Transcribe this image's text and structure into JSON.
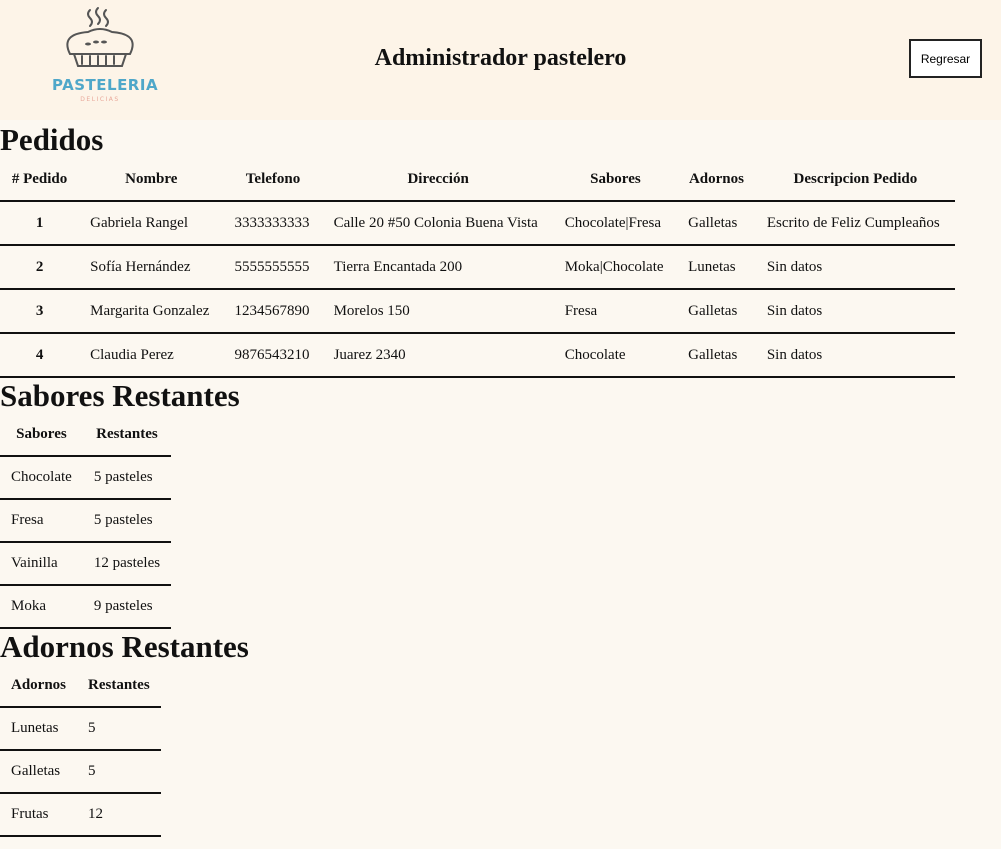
{
  "header": {
    "logo_text": "PASTELERIA",
    "logo_sub": "DELICIAS",
    "title": "Administrador pastelero",
    "back_label": "Regresar"
  },
  "pedidos": {
    "title": "Pedidos",
    "columns": [
      "# Pedido",
      "Nombre",
      "Telefono",
      "Dirección",
      "Sabores",
      "Adornos",
      "Descripcion Pedido"
    ],
    "rows": [
      [
        "1",
        "Gabriela Rangel",
        "3333333333",
        "Calle 20 #50 Colonia Buena Vista",
        "Chocolate|Fresa",
        "Galletas",
        "Escrito de Feliz Cumpleaños"
      ],
      [
        "2",
        "Sofía Hernández",
        "5555555555",
        "Tierra Encantada 200",
        "Moka|Chocolate",
        "Lunetas",
        "Sin datos"
      ],
      [
        "3",
        "Margarita Gonzalez",
        "1234567890",
        "Morelos 150",
        "Fresa",
        "Galletas",
        "Sin datos"
      ],
      [
        "4",
        "Claudia Perez",
        "9876543210",
        "Juarez 2340",
        "Chocolate",
        "Galletas",
        "Sin datos"
      ]
    ]
  },
  "sabores": {
    "title": "Sabores Restantes",
    "columns": [
      "Sabores",
      "Restantes"
    ],
    "rows": [
      [
        "Chocolate",
        "5 pasteles"
      ],
      [
        "Fresa",
        "5 pasteles"
      ],
      [
        "Vainilla",
        "12 pasteles"
      ],
      [
        "Moka",
        "9 pasteles"
      ]
    ]
  },
  "adornos": {
    "title": "Adornos Restantes",
    "columns": [
      "Adornos",
      "Restantes"
    ],
    "rows": [
      [
        "Lunetas",
        "5"
      ],
      [
        "Galletas",
        "5"
      ],
      [
        "Frutas",
        "12"
      ]
    ]
  }
}
